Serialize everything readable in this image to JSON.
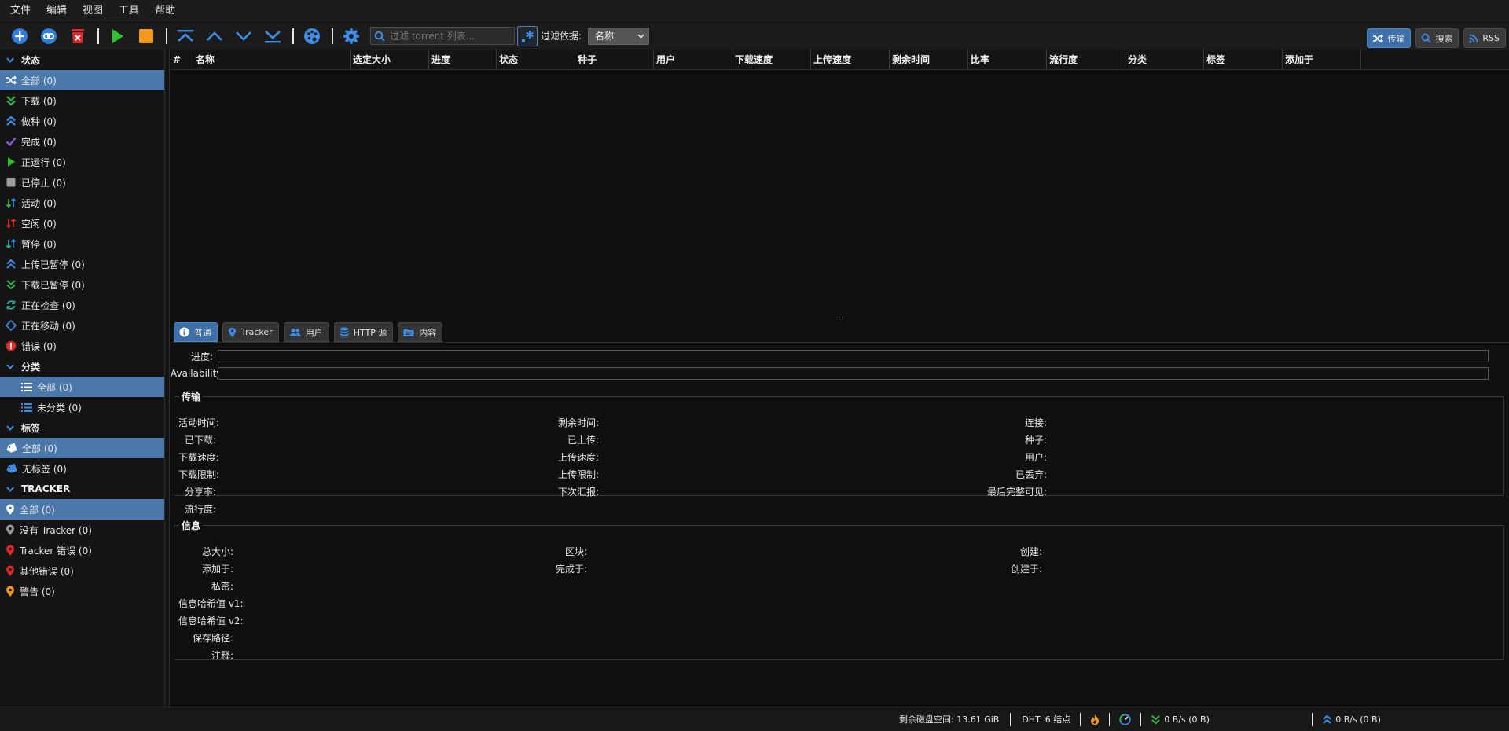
{
  "menubar": {
    "items": [
      "文件",
      "编辑",
      "视图",
      "工具",
      "帮助"
    ]
  },
  "toolbar": {
    "filter_placeholder": "过滤 torrent 列表...",
    "filter_by_label": "过滤依据:",
    "filter_by_value": "名称",
    "view_tabs": [
      {
        "label": "传输",
        "icon": "shuffle-icon",
        "active": true
      },
      {
        "label": "搜索",
        "icon": "search-icon",
        "active": false
      },
      {
        "label": "RSS",
        "icon": "rss-icon",
        "active": false
      }
    ]
  },
  "sidebar": {
    "status": {
      "header": "状态",
      "items": [
        {
          "label": "全部 (0)",
          "icon": "shuffle-icon",
          "selected": true
        },
        {
          "label": "下载 (0)",
          "icon": "double-chevron-down-icon"
        },
        {
          "label": "做种 (0)",
          "icon": "double-chevron-up-icon"
        },
        {
          "label": "完成 (0)",
          "icon": "check-icon"
        },
        {
          "label": "正运行 (0)",
          "icon": "play-icon"
        },
        {
          "label": "已停止 (0)",
          "icon": "stop-icon"
        },
        {
          "label": "活动 (0)",
          "icon": "updown-active-icon"
        },
        {
          "label": "空闲 (0)",
          "icon": "updown-inactive-icon"
        },
        {
          "label": "暂停 (0)",
          "icon": "updown-paused-icon"
        },
        {
          "label": "上传已暂停 (0)",
          "icon": "upload-paused-icon"
        },
        {
          "label": "下载已暂停 (0)",
          "icon": "download-paused-icon"
        },
        {
          "label": "正在检查 (0)",
          "icon": "refresh-icon"
        },
        {
          "label": "正在移动 (0)",
          "icon": "move-icon"
        },
        {
          "label": "错误 (0)",
          "icon": "error-icon"
        }
      ]
    },
    "categories": {
      "header": "分类",
      "items": [
        {
          "label": "全部 (0)",
          "icon": "list-icon",
          "selected": true
        },
        {
          "label": "未分类 (0)",
          "icon": "list-icon"
        }
      ]
    },
    "tags": {
      "header": "标签",
      "items": [
        {
          "label": "全部 (0)",
          "icon": "tag-icon",
          "selected": true
        },
        {
          "label": "无标签 (0)",
          "icon": "tag-icon"
        }
      ]
    },
    "trackers": {
      "header": "TRACKER",
      "items": [
        {
          "label": "全部 (0)",
          "icon": "location-pin-icon",
          "selected": true
        },
        {
          "label": "没有 Tracker (0)",
          "icon": "location-pin-icon"
        },
        {
          "label": "Tracker 错误 (0)",
          "icon": "location-pin-icon"
        },
        {
          "label": "其他错误 (0)",
          "icon": "location-pin-icon"
        },
        {
          "label": "警告 (0)",
          "icon": "location-pin-icon"
        }
      ]
    }
  },
  "table": {
    "columns": [
      "#",
      "名称",
      "选定大小",
      "进度",
      "状态",
      "种子",
      "用户",
      "下载速度",
      "上传速度",
      "剩余时间",
      "比率",
      "流行度",
      "分类",
      "标签",
      "添加于"
    ]
  },
  "props": {
    "tabs": [
      {
        "label": "普通",
        "icon": "info-icon",
        "active": true
      },
      {
        "label": "Tracker",
        "icon": "location-pin-icon"
      },
      {
        "label": "用户",
        "icon": "users-icon"
      },
      {
        "label": "HTTP 源",
        "icon": "database-icon"
      },
      {
        "label": "内容",
        "icon": "folder-icon"
      }
    ],
    "progress_label": "进度:",
    "availability_label": "Availability:",
    "transfer": {
      "title": "传输",
      "col1": [
        "活动时间:",
        "已下载:",
        "下载速度:",
        "下载限制:",
        "分享率:",
        "流行度:"
      ],
      "col2": [
        "剩余时间:",
        "已上传:",
        "上传速度:",
        "上传限制:",
        "下次汇报:"
      ],
      "col3": [
        "连接:",
        "种子:",
        "用户:",
        "已丢弃:",
        "最后完整可见:"
      ]
    },
    "info": {
      "title": "信息",
      "col1": [
        "总大小:",
        "添加于:",
        "私密:",
        "信息哈希值 v1:",
        "信息哈希值 v2:",
        "保存路径:",
        "注释:"
      ],
      "col2": [
        "区块:",
        "完成于:"
      ],
      "col3": [
        "创建:",
        "创建于:"
      ]
    }
  },
  "statusbar": {
    "disk": "剩余磁盘空间: 13.61 GiB",
    "dht": "DHT: 6 结点",
    "download": "0 B/s (0 B)",
    "upload": "0 B/s (0 B)"
  }
}
